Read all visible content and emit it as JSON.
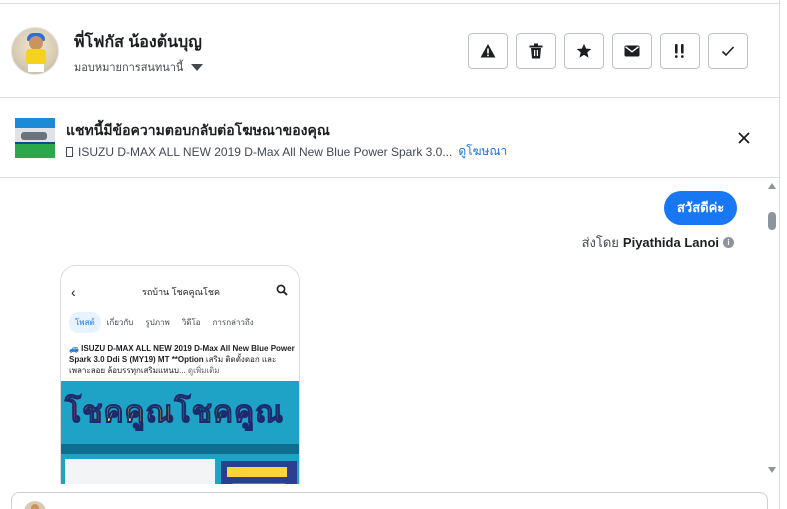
{
  "header": {
    "contact_name": "พี่โฟกัส น้องต้นบุญ",
    "assign_label": "มอบหมายการสนทนานี้"
  },
  "actions": [
    {
      "name": "report-icon",
      "label": "Report"
    },
    {
      "name": "trash-icon",
      "label": "Delete"
    },
    {
      "name": "star-icon",
      "label": "Star"
    },
    {
      "name": "envelope-icon",
      "label": "Mark unread"
    },
    {
      "name": "double-exclamation-icon",
      "label": "Follow up"
    },
    {
      "name": "checkmark-icon",
      "label": "Done"
    }
  ],
  "ad_banner": {
    "title": "แชทนี้มีข้อความตอบกลับต่อโฆษณาของคุณ",
    "ad_text": "ISUZU D-MAX ALL NEW 2019 D-Max All New Blue Power Spark 3.0...",
    "view_ad_link": "ดูโฆษณา"
  },
  "conversation": {
    "outgoing_message": "สวัสดีค่ะ",
    "sent_by_prefix": "ส่งโดย",
    "sent_by_name": "Piyathida Lanoi",
    "shared_post": {
      "page_name": "รถบ้าน โชคคูณโชค",
      "tabs": [
        "โพสต์",
        "เกี่ยวกับ",
        "รูปภาพ",
        "วิดีโอ",
        "การกล่าวถึง"
      ],
      "active_tab": "โพสต์",
      "post_text_bold": "🚙 ISUZU D-MAX ALL NEW 2019 D-Max All New Blue Power Spark 3.0 Ddi S (MY19) MT **Option",
      "post_text_rest": " เสริม ติดตั้งดอก และเพลาะลอย ล้อบรรทุกเสริมแหนบ...",
      "see_more": "ดูเพิ่มเติม",
      "banner_text": [
        "โช",
        "คคูณ",
        "โชค",
        "คูณ"
      ]
    }
  },
  "colors": {
    "accent": "#1877f2",
    "border": "#dadde1",
    "text": "#1c1e21",
    "muted": "#444950"
  }
}
